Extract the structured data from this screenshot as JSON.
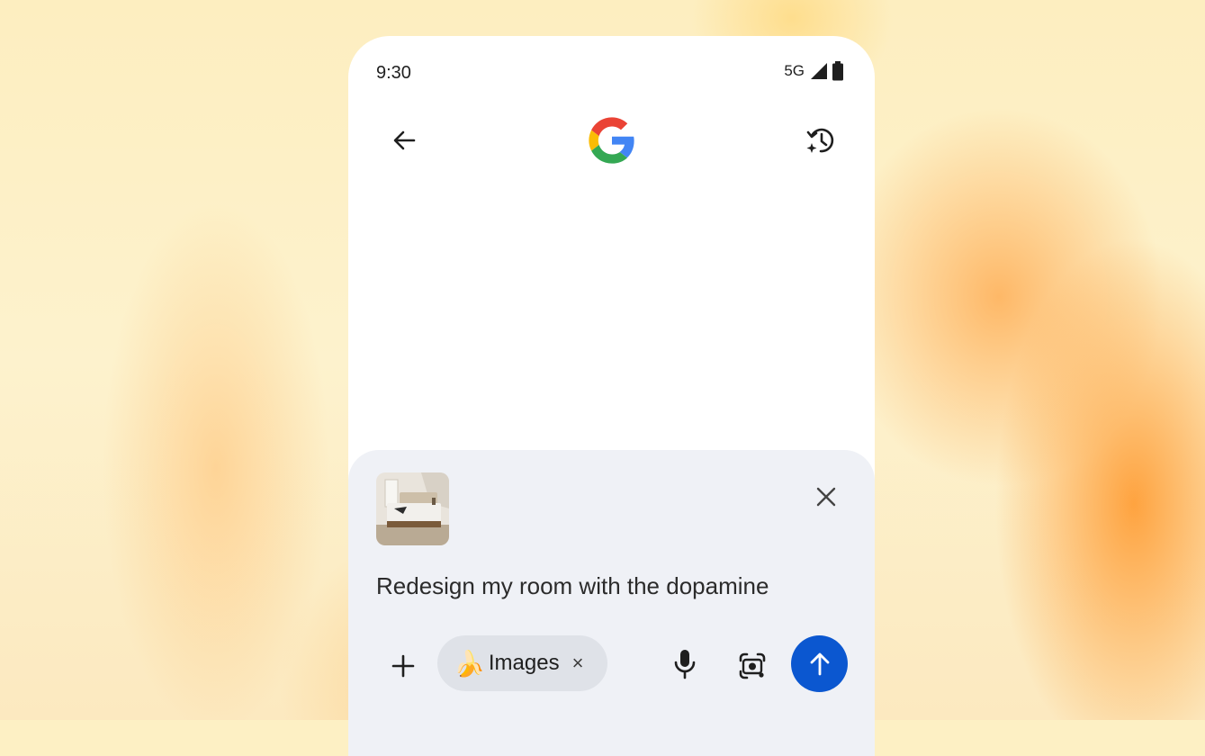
{
  "status_bar": {
    "time": "9:30",
    "network": "5G",
    "icons": [
      "signal-icon",
      "battery-icon"
    ]
  },
  "header": {
    "back_icon": "arrow-back-icon",
    "logo": "google-g-logo",
    "history_icon": "history-sparkle-icon"
  },
  "composer": {
    "attachment": {
      "type": "image-thumbnail",
      "close_icon": "close-icon"
    },
    "prompt_text": "Redesign my room with the dopamine",
    "add_icon": "plus-icon",
    "chip": {
      "emoji": "🍌",
      "label": "Images",
      "remove": "×"
    },
    "mic_icon": "mic-icon",
    "lens_icon": "lens-camera-icon",
    "send_icon": "arrow-up-icon"
  },
  "colors": {
    "send_button": "#0b57d0",
    "sheet_bg": "#eff1f6",
    "chip_bg": "#dfe2e8",
    "background": "#fdeec0"
  }
}
